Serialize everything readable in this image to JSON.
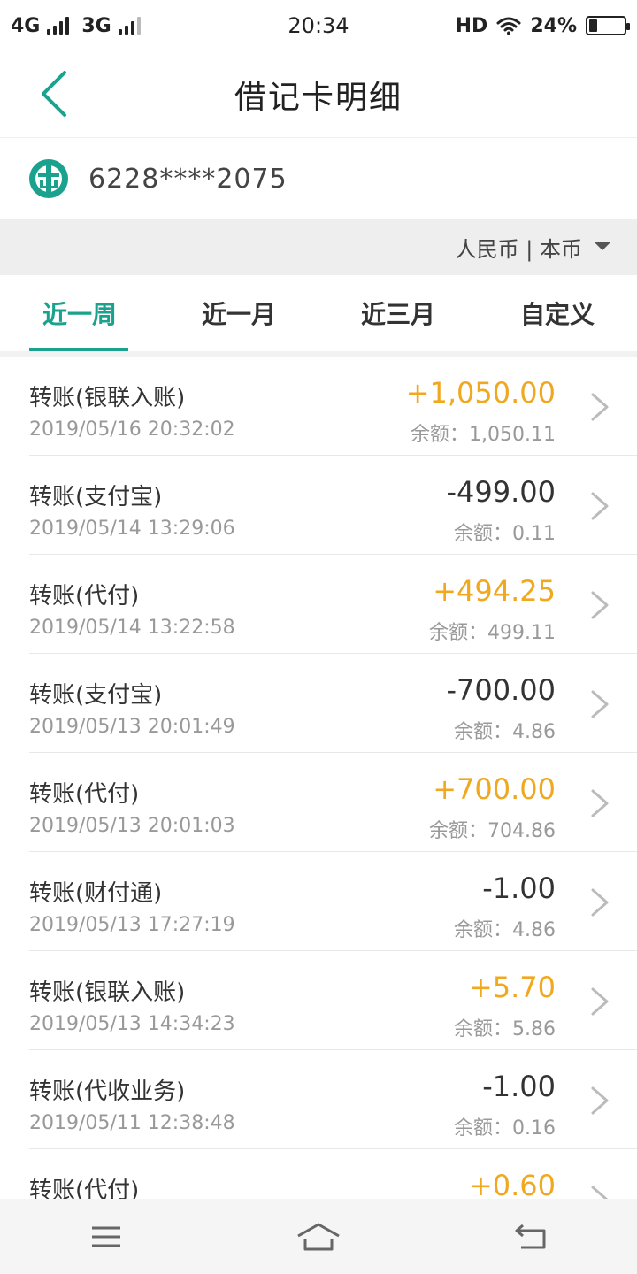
{
  "status_bar": {
    "network1": "4G",
    "network2": "3G",
    "time": "20:34",
    "hd": "HD",
    "battery": "24%",
    "battery_level": 0.24
  },
  "header": {
    "title": "借记卡明细"
  },
  "card": {
    "number": "6228****2075"
  },
  "currency": {
    "label": "人民币 | 本币"
  },
  "tabs": [
    {
      "label": "近一周",
      "active": true
    },
    {
      "label": "近一月",
      "active": false
    },
    {
      "label": "近三月",
      "active": false
    },
    {
      "label": "自定义",
      "active": false
    }
  ],
  "transactions": [
    {
      "title": "转账(银联入账)",
      "time": "2019/05/16 20:32:02",
      "amount": "+1,050.00",
      "balance": "余额：1,050.11",
      "direction": "in"
    },
    {
      "title": "转账(支付宝)",
      "time": "2019/05/14 13:29:06",
      "amount": "-499.00",
      "balance": "余额：0.11",
      "direction": "out"
    },
    {
      "title": "转账(代付)",
      "time": "2019/05/14 13:22:58",
      "amount": "+494.25",
      "balance": "余额：499.11",
      "direction": "in"
    },
    {
      "title": "转账(支付宝)",
      "time": "2019/05/13 20:01:49",
      "amount": "-700.00",
      "balance": "余额：4.86",
      "direction": "out"
    },
    {
      "title": "转账(代付)",
      "time": "2019/05/13 20:01:03",
      "amount": "+700.00",
      "balance": "余额：704.86",
      "direction": "in"
    },
    {
      "title": "转账(财付通)",
      "time": "2019/05/13 17:27:19",
      "amount": "-1.00",
      "balance": "余额：4.86",
      "direction": "out"
    },
    {
      "title": "转账(银联入账)",
      "time": "2019/05/13 14:34:23",
      "amount": "+5.70",
      "balance": "余额：5.86",
      "direction": "in"
    },
    {
      "title": "转账(代收业务)",
      "time": "2019/05/11 12:38:48",
      "amount": "-1.00",
      "balance": "余额：0.16",
      "direction": "out"
    },
    {
      "title": "转账(代付)",
      "time": "",
      "amount": "+0.60",
      "balance": "",
      "direction": "in"
    }
  ],
  "colors": {
    "accent": "#1aa28e",
    "income": "#f0a81e",
    "expense": "#333333"
  },
  "icons": {
    "back": "chevron-left-icon",
    "bank_logo": "abc-bank-logo-icon",
    "caret": "caret-down-icon",
    "row_chevron": "chevron-right-icon",
    "nav_menu": "menu-icon",
    "nav_home": "home-icon",
    "nav_back": "return-icon"
  }
}
